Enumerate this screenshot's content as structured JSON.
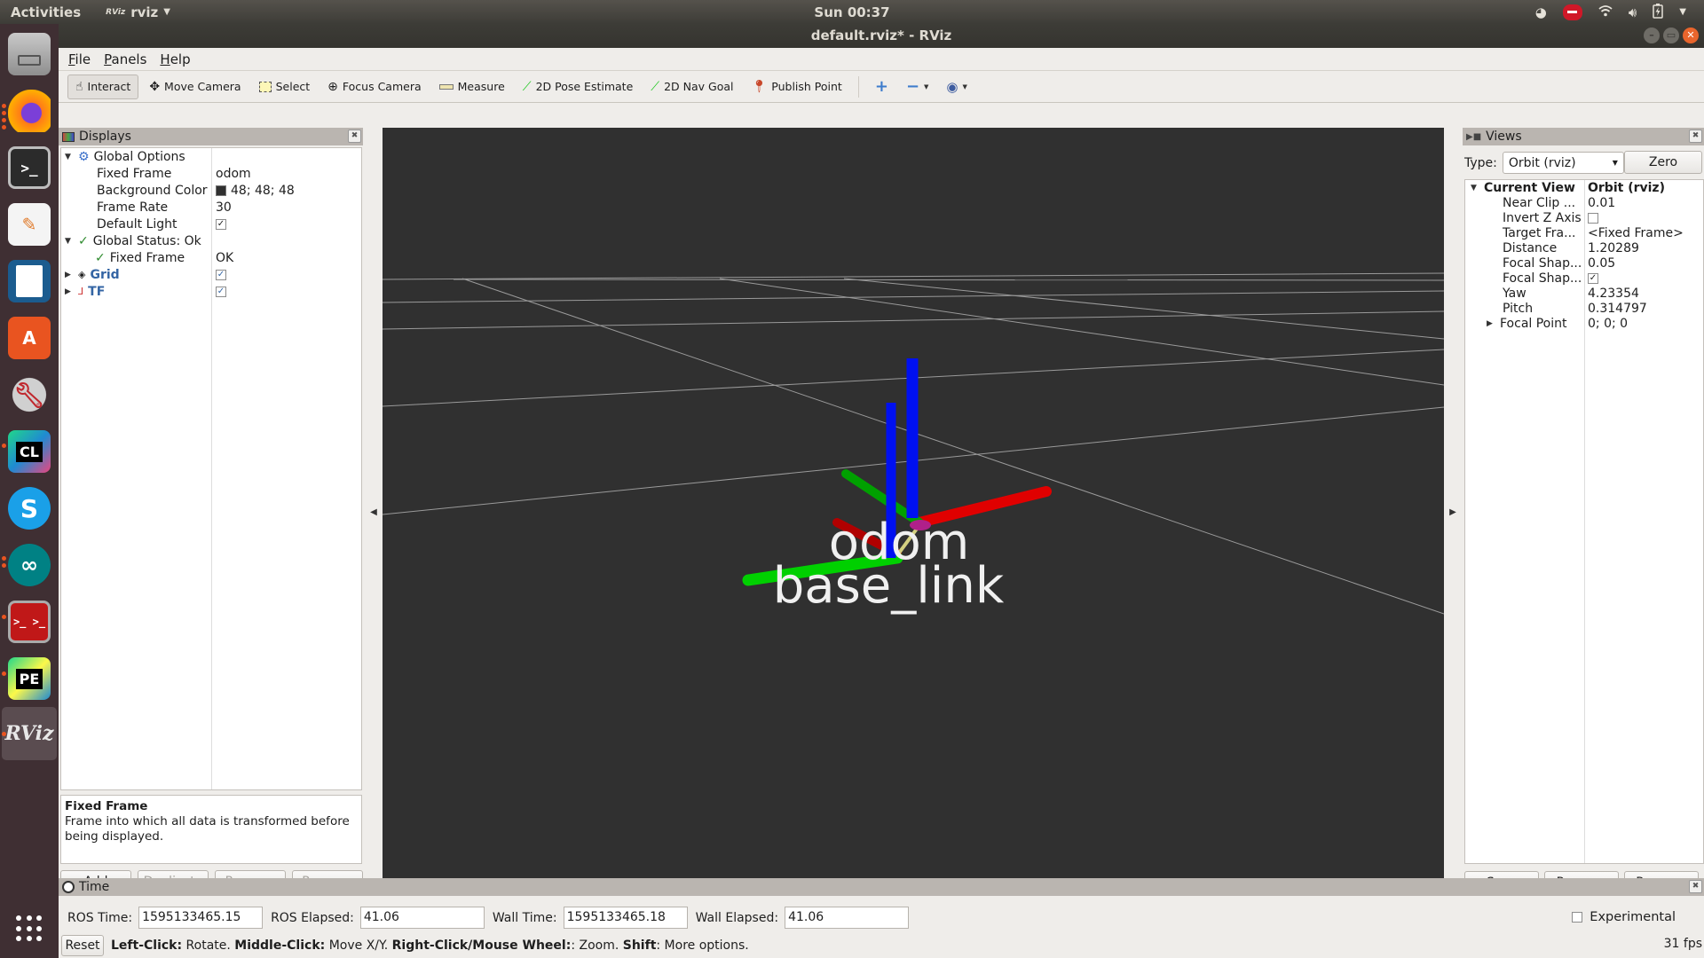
{
  "topbar": {
    "activities": "Activities",
    "app_menu_icon": "RViz",
    "app_menu_label": "rviz",
    "clock": "Sun 00:37",
    "tray_icons": [
      "update-icon",
      "do-not-disturb-icon",
      "wifi-icon",
      "volume-icon",
      "battery-icon",
      "system-menu-chevron-icon"
    ]
  },
  "dock": {
    "items": [
      {
        "name": "files",
        "label": "Files",
        "running": false
      },
      {
        "name": "firefox",
        "label": "Firefox",
        "running": true
      },
      {
        "name": "terminal",
        "label": "Terminal",
        "running": false
      },
      {
        "name": "text-editor",
        "label": "Text Editor",
        "running": false
      },
      {
        "name": "libreoffice-writer",
        "label": "LibreOffice Writer",
        "running": false
      },
      {
        "name": "software",
        "label": "Ubuntu Software",
        "running": false
      },
      {
        "name": "settings",
        "label": "Settings",
        "running": false
      },
      {
        "name": "clion",
        "label": "CL",
        "running": true
      },
      {
        "name": "skype",
        "label": "S",
        "running": false
      },
      {
        "name": "arduino",
        "label": "Arduino",
        "running": true
      },
      {
        "name": "terminator",
        "label": "Terminator",
        "running": true
      },
      {
        "name": "pycharm",
        "label": "PE",
        "running": true
      },
      {
        "name": "rviz",
        "label": "RViz",
        "running": true,
        "active": true
      }
    ],
    "show_apps": "show-applications-icon"
  },
  "window": {
    "title": "default.rviz* - RViz",
    "menu": [
      "File",
      "Panels",
      "Help"
    ],
    "toolbar": [
      {
        "label": "Interact",
        "icon": "hand-pointer-icon",
        "active": true
      },
      {
        "label": "Move Camera",
        "icon": "move-camera-icon"
      },
      {
        "label": "Select",
        "icon": "select-box-icon"
      },
      {
        "label": "Focus Camera",
        "icon": "focus-camera-icon"
      },
      {
        "label": "Measure",
        "icon": "ruler-icon"
      },
      {
        "label": "2D Pose Estimate",
        "icon": "green-arrow-icon"
      },
      {
        "label": "2D Nav Goal",
        "icon": "green-arrow-icon"
      },
      {
        "label": "Publish Point",
        "icon": "map-pin-icon"
      }
    ],
    "toolbar_extra": [
      "add-tool-icon",
      "remove-tool-icon",
      "view-menu-icon"
    ]
  },
  "displays": {
    "title": "Displays",
    "tree": {
      "global_options": "Global Options",
      "fixed_frame_label": "Fixed Frame",
      "fixed_frame_value": "odom",
      "bg_color_label": "Background Color",
      "bg_color_value": "48; 48; 48",
      "bg_color_hex": "#303030",
      "frame_rate_label": "Frame Rate",
      "frame_rate_value": "30",
      "default_light_label": "Default Light",
      "default_light_checked": true,
      "global_status": "Global Status: Ok",
      "status_fixed_frame_label": "Fixed Frame",
      "status_fixed_frame_value": "OK",
      "grid_label": "Grid",
      "grid_checked": true,
      "tf_label": "TF",
      "tf_checked": true
    },
    "description_title": "Fixed Frame",
    "description_text": "Frame into which all data is transformed before being displayed.",
    "buttons": {
      "add": "Add",
      "duplicate": "Duplicate",
      "remove": "Remove",
      "rename": "Rename"
    }
  },
  "viewport": {
    "background": "#303030",
    "frame_labels": [
      "odom",
      "base_link"
    ],
    "axis_colors": {
      "x": "#e00000",
      "y": "#00d000",
      "z": "#0010f0"
    }
  },
  "views": {
    "title": "Views",
    "type_label": "Type:",
    "type_value": "Orbit (rviz)",
    "zero": "Zero",
    "current_view": "Current View",
    "current_view_value": "Orbit (rviz)",
    "props": [
      {
        "label": "Near Clip ...",
        "value": "0.01"
      },
      {
        "label": "Invert Z Axis",
        "checkbox": false
      },
      {
        "label": "Target Fra...",
        "value": "<Fixed Frame>"
      },
      {
        "label": "Distance",
        "value": "1.20289"
      },
      {
        "label": "Focal Shap...",
        "value": "0.05"
      },
      {
        "label": "Focal Shap...",
        "checkbox": true
      },
      {
        "label": "Yaw",
        "value": "4.23354"
      },
      {
        "label": "Pitch",
        "value": "0.314797"
      },
      {
        "label": "Focal Point",
        "value": "0; 0; 0",
        "expandable": true
      }
    ],
    "buttons": {
      "save": "Save",
      "remove": "Remove",
      "rename": "Rename"
    }
  },
  "time": {
    "title": "Time",
    "ros_time_label": "ROS Time:",
    "ros_time": "1595133465.15",
    "ros_elapsed_label": "ROS Elapsed:",
    "ros_elapsed": "41.06",
    "wall_time_label": "Wall Time:",
    "wall_time": "1595133465.18",
    "wall_elapsed_label": "Wall Elapsed:",
    "wall_elapsed": "41.06",
    "experimental": "Experimental",
    "experimental_checked": false,
    "reset": "Reset",
    "help": [
      {
        "bold": "Left-Click:",
        "text": " Rotate. "
      },
      {
        "bold": "Middle-Click:",
        "text": " Move X/Y. "
      },
      {
        "bold": "Right-Click/Mouse Wheel:",
        "text": ": Zoom. "
      },
      {
        "bold": "Shift",
        "text": ": More options."
      }
    ],
    "fps": "31 fps"
  }
}
